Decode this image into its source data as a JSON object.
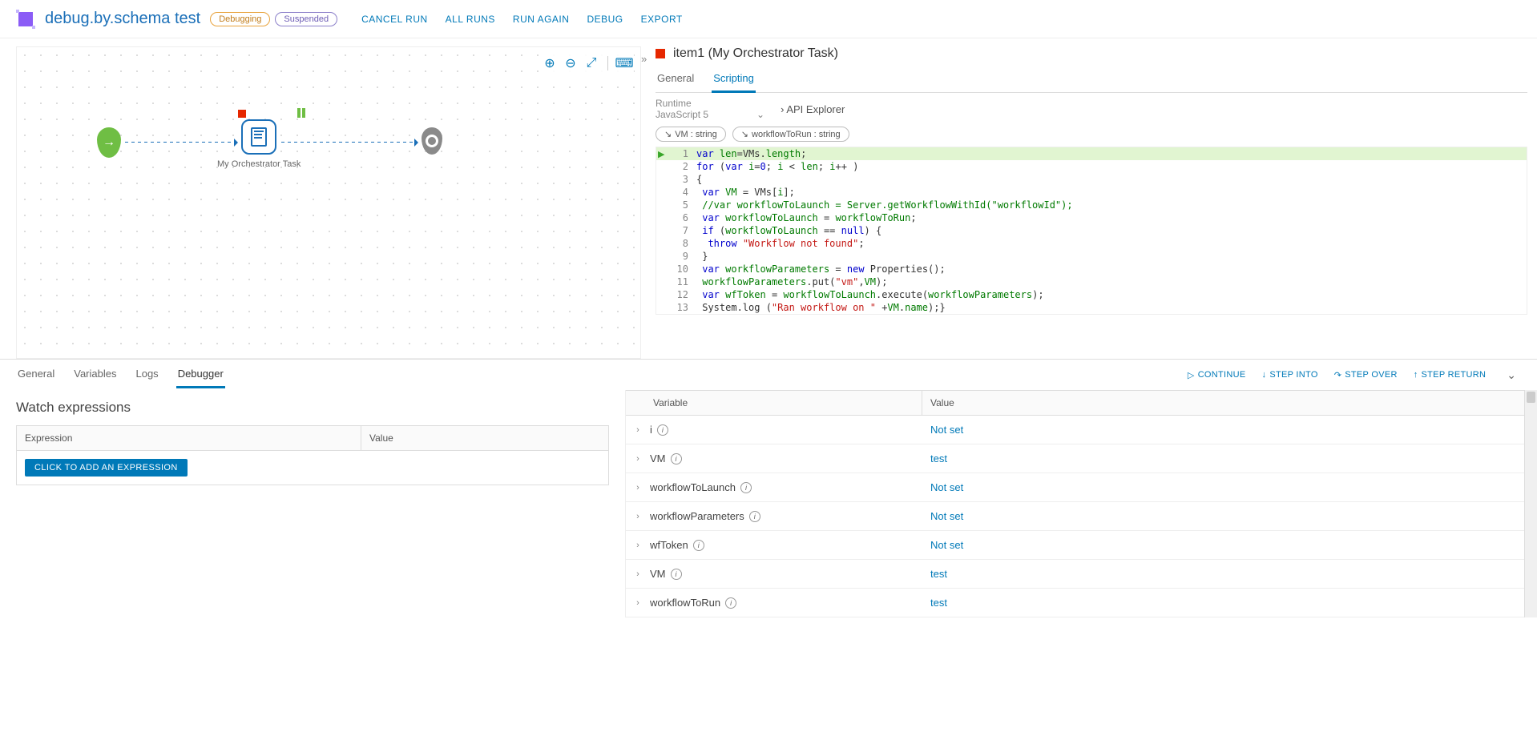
{
  "header": {
    "title": "debug.by.schema test",
    "badge_debugging": "Debugging",
    "badge_suspended": "Suspended",
    "actions": {
      "cancel": "CANCEL RUN",
      "all_runs": "ALL RUNS",
      "run_again": "RUN AGAIN",
      "debug": "DEBUG",
      "export": "EXPORT"
    }
  },
  "canvas": {
    "task_label": "My Orchestrator Task"
  },
  "detail": {
    "item_title": "item1 (My Orchestrator Task)",
    "tabs": {
      "general": "General",
      "scripting": "Scripting"
    },
    "runtime_label": "Runtime",
    "runtime_value": "JavaScript 5",
    "api_explorer": "API Explorer",
    "chips": {
      "vm": "VM : string",
      "wf": "workflowToRun : string"
    },
    "code": [
      {
        "n": "1",
        "hl": true,
        "html": "<span class='kw'>var</span> <span class='prop'>len</span>=VMs.<span class='prop'>length</span>;"
      },
      {
        "n": "2",
        "html": "<span class='kw'>for</span> (<span class='kw'>var</span> <span class='prop'>i</span>=<span class='num'>0</span>; <span class='prop'>i</span> &lt; <span class='prop'>len</span>; <span class='prop'>i</span>++ )"
      },
      {
        "n": "3",
        "html": "{"
      },
      {
        "n": "4",
        "html": " <span class='kw'>var</span> <span class='prop'>VM</span> = VMs[<span class='prop'>i</span>];"
      },
      {
        "n": "5",
        "html": " <span class='cmt'>//var workflowToLaunch = Server.getWorkflowWithId(\"workflowId\");</span>"
      },
      {
        "n": "6",
        "html": " <span class='kw'>var</span> <span class='prop'>workflowToLaunch</span> = <span class='prop'>workflowToRun</span>;"
      },
      {
        "n": "7",
        "html": " <span class='kw'>if</span> (<span class='prop'>workflowToLaunch</span> == <span class='kw'>null</span>) {"
      },
      {
        "n": "8",
        "html": "  <span class='kw'>throw</span> <span class='str'>\"Workflow not found\"</span>;"
      },
      {
        "n": "9",
        "html": " }"
      },
      {
        "n": "10",
        "html": " <span class='kw'>var</span> <span class='prop'>workflowParameters</span> = <span class='kw'>new</span> Properties();"
      },
      {
        "n": "11",
        "html": " <span class='prop'>workflowParameters</span>.put(<span class='str'>\"vm\"</span>,<span class='prop'>VM</span>);"
      },
      {
        "n": "12",
        "html": " <span class='kw'>var</span> <span class='prop'>wfToken</span> = <span class='prop'>workflowToLaunch</span>.execute(<span class='prop'>workflowParameters</span>);"
      },
      {
        "n": "13",
        "html": " System.log (<span class='str'>\"Ran workflow on \"</span> +<span class='prop'>VM</span>.<span class='prop'>name</span>);}"
      }
    ]
  },
  "bottom": {
    "tabs": {
      "general": "General",
      "variables": "Variables",
      "logs": "Logs",
      "debugger": "Debugger"
    },
    "actions": {
      "continue": "CONTINUE",
      "step_into": "STEP INTO",
      "step_over": "STEP OVER",
      "step_return": "STEP RETURN"
    },
    "watch": {
      "title": "Watch expressions",
      "col_expr": "Expression",
      "col_val": "Value",
      "add_btn": "CLICK TO ADD AN EXPRESSION"
    },
    "vars": {
      "col_var": "Variable",
      "col_val": "Value",
      "rows": [
        {
          "name": "i",
          "value": "Not set"
        },
        {
          "name": "VM",
          "value": "test"
        },
        {
          "name": "workflowToLaunch",
          "value": "Not set"
        },
        {
          "name": "workflowParameters",
          "value": "Not set"
        },
        {
          "name": "wfToken",
          "value": "Not set"
        },
        {
          "name": "VM",
          "value": "test"
        },
        {
          "name": "workflowToRun",
          "value": "test"
        }
      ]
    }
  }
}
